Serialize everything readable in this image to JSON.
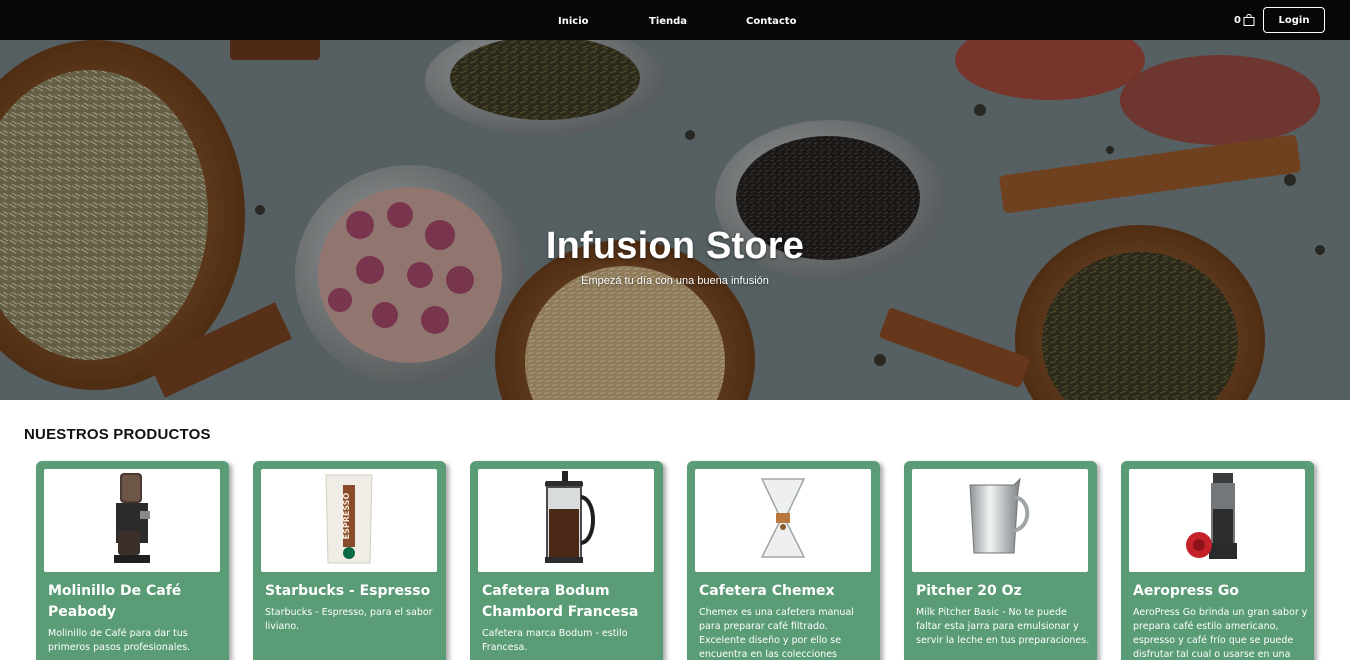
{
  "nav": {
    "links": [
      "Inicio",
      "Tienda",
      "Contacto"
    ],
    "cart_count": "0",
    "login_label": "Login"
  },
  "hero": {
    "title": "Infusion Store",
    "subtitle": "Empezá tu día con una buena infusión"
  },
  "products": {
    "heading": "NUESTROS PRODUCTOS",
    "items": [
      {
        "title": "Molinillo De Café Peabody",
        "desc": "Molinillo de Café para dar tus primeros pasos profesionales."
      },
      {
        "title": "Starbucks - Espresso",
        "desc": "Starbucks - Espresso, para el sabor liviano."
      },
      {
        "title": "Cafetera Bodum Chambord Francesa",
        "desc": "Cafetera marca Bodum - estilo Francesa."
      },
      {
        "title": "Cafetera Chemex",
        "desc": "Chemex es una cafetera manual para preparar café filtrado. Excelente diseño y por ello se encuentra en las colecciones"
      },
      {
        "title": "Pitcher 20 Oz",
        "desc": "Milk Pitcher Basic - No te puede faltar esta jarra para emulsionar y servir la leche en tus preparaciones."
      },
      {
        "title": "Aeropress Go",
        "desc": "AeroPress Go brinda un gran sabor y prepara café estilo americano, espresso y café frío que se puede disfrutar tal cual o usarse en una"
      }
    ]
  },
  "colors": {
    "navbar": "#070707",
    "card": "#5a9c76",
    "hero_bg": "#3c454a"
  }
}
